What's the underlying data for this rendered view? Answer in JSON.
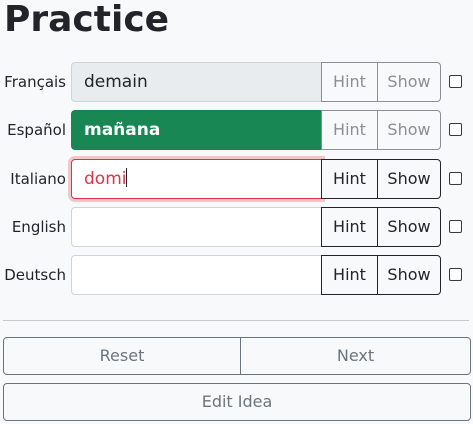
{
  "page": {
    "title": "Practice"
  },
  "languages": [
    {
      "label": "Français",
      "value": "demain",
      "state": "disabled",
      "hint": "Hint",
      "show": "Show",
      "buttons_enabled": false
    },
    {
      "label": "Español",
      "value": "mañana",
      "state": "correct",
      "hint": "Hint",
      "show": "Show",
      "buttons_enabled": false
    },
    {
      "label": "Italiano",
      "value": "domi",
      "state": "invalid",
      "hint": "Hint",
      "show": "Show",
      "buttons_enabled": true
    },
    {
      "label": "English",
      "value": "",
      "state": "empty",
      "hint": "Hint",
      "show": "Show",
      "buttons_enabled": true
    },
    {
      "label": "Deutsch",
      "value": "",
      "state": "empty",
      "hint": "Hint",
      "show": "Show",
      "buttons_enabled": true
    }
  ],
  "actions": {
    "reset": "Reset",
    "next": "Next",
    "edit": "Edit Idea"
  },
  "colors": {
    "correct": "#198754",
    "invalid": "#dc3545",
    "disabled_field": "#e9ecef"
  }
}
